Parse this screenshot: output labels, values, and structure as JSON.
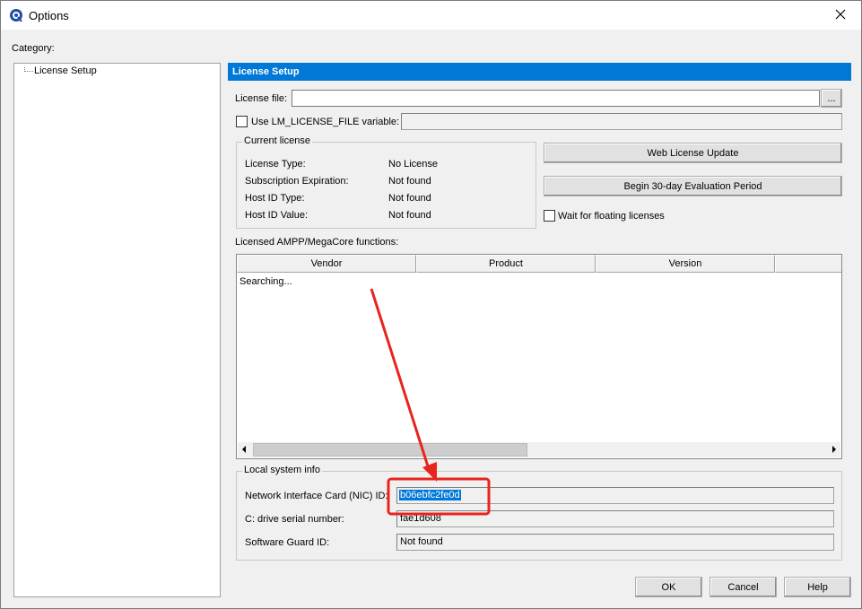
{
  "window": {
    "title": "Options",
    "close_icon": "close-icon",
    "app_icon": "quartus-icon"
  },
  "category": {
    "label": "Category:",
    "tree_items": [
      "License Setup"
    ]
  },
  "panel": {
    "header": "License Setup",
    "license_file_label": "License file:",
    "license_file_value": "",
    "browse_label": "...",
    "use_lm_label": "Use LM_LICENSE_FILE variable:",
    "use_lm_checked": false,
    "current_license": {
      "legend": "Current license",
      "rows": [
        {
          "label": "License Type:",
          "value": "No License"
        },
        {
          "label": "Subscription Expiration:",
          "value": "Not found"
        },
        {
          "label": "Host ID Type:",
          "value": "Not found"
        },
        {
          "label": "Host ID Value:",
          "value": "Not found"
        }
      ]
    },
    "web_update_label": "Web License Update",
    "evaluation_label": "Begin 30-day Evaluation Period",
    "wait_floating_label": "Wait for floating licenses",
    "wait_floating_checked": false,
    "functions_label": "Licensed AMPP/MegaCore functions:",
    "columns": [
      "Vendor",
      "Product",
      "Version"
    ],
    "list_status": "Searching...",
    "local_info": {
      "legend": "Local system info",
      "nic_label": "Network Interface Card (NIC) ID:",
      "nic_value": "b06ebfc2fe0d",
      "drive_label": "C: drive serial number:",
      "drive_value": "fae1d608",
      "guard_label": "Software Guard ID:",
      "guard_value": "Not found"
    }
  },
  "footer": {
    "ok": "OK",
    "cancel": "Cancel",
    "help": "Help"
  },
  "annotation": {
    "color": "#e8241e"
  }
}
